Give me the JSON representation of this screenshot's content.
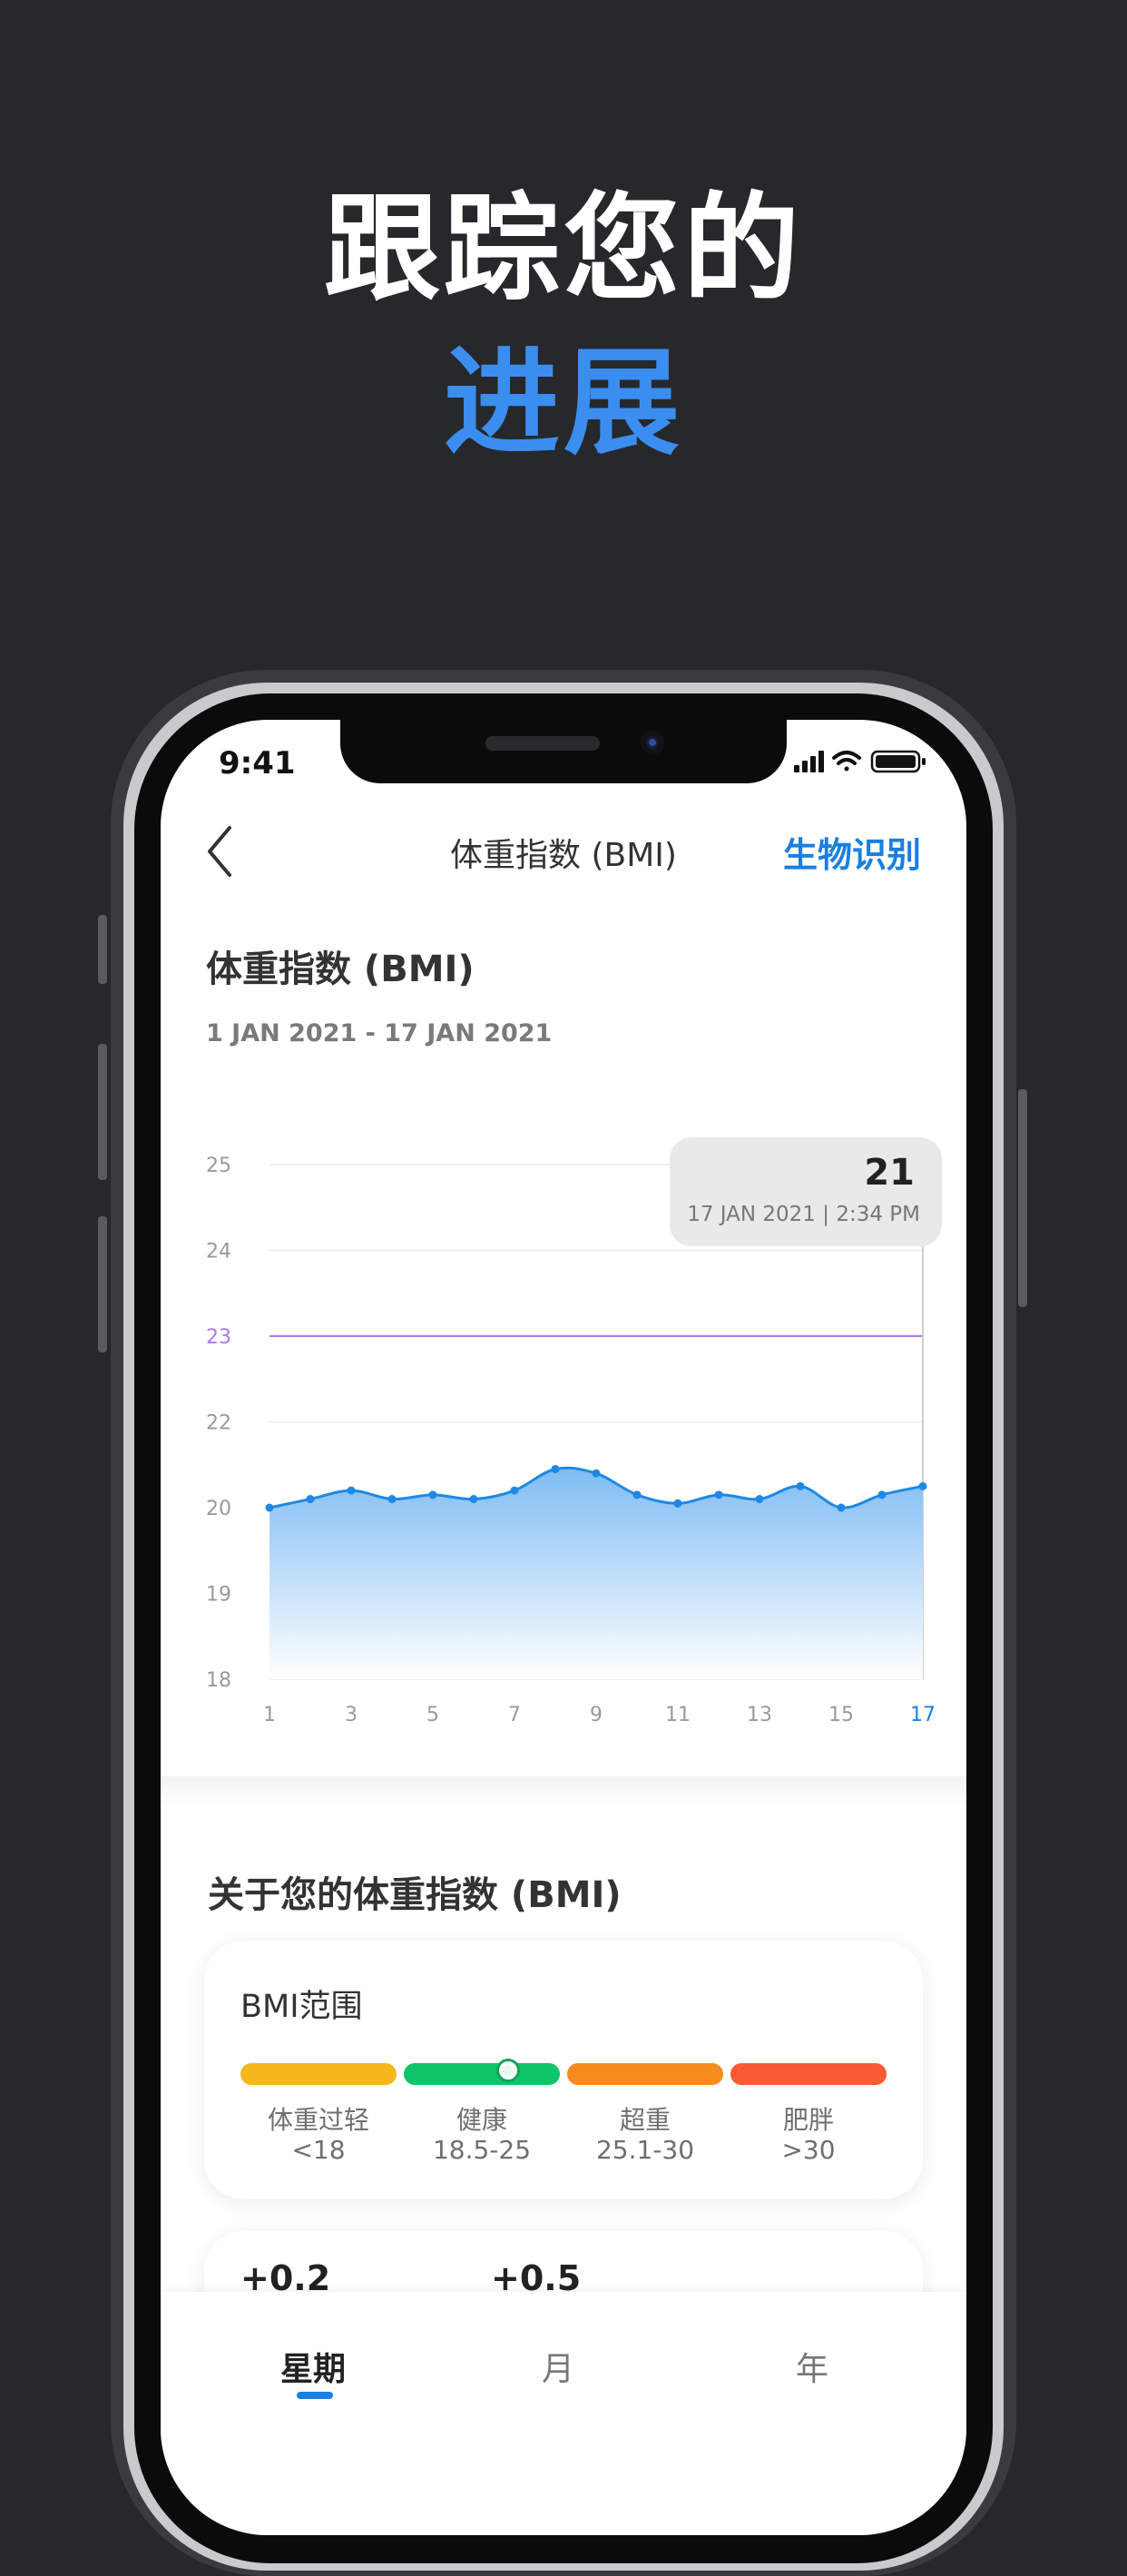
{
  "promo": {
    "line1": "跟踪您的",
    "line2": "进展"
  },
  "status_bar": {
    "time": "9:41"
  },
  "nav": {
    "title": "体重指数 (BMI)",
    "action": "生物识别"
  },
  "card": {
    "title": "体重指数 (BMI)",
    "date_range": "1 JAN 2021 - 17 JAN 2021"
  },
  "tooltip": {
    "value": "21",
    "date": "17 JAN 2021 | 2:34 PM"
  },
  "chart_data": {
    "type": "area",
    "y_ticks": [
      "25",
      "24",
      "23",
      "22",
      "20",
      "19",
      "18"
    ],
    "x_ticks": [
      "1",
      "3",
      "5",
      "7",
      "9",
      "11",
      "13",
      "15",
      "17"
    ],
    "x": [
      1,
      2,
      3,
      4,
      5,
      6,
      7,
      8,
      9,
      10,
      11,
      12,
      13,
      14,
      15,
      16,
      17
    ],
    "values": [
      20.0,
      20.2,
      20.4,
      20.2,
      20.3,
      20.2,
      20.4,
      20.9,
      20.8,
      20.3,
      20.1,
      20.3,
      20.2,
      20.5,
      20.0,
      20.3,
      20.5
    ],
    "reference_line": {
      "label": "23",
      "color": "#a97be6"
    },
    "highlight_x": "17",
    "series_color": "#1e88e5"
  },
  "about": {
    "title": "关于您的体重指数 (BMI)"
  },
  "bmi_range": {
    "title": "BMI范围",
    "segments": [
      {
        "label": "体重过轻",
        "range": "<18",
        "color": "#f5b71c"
      },
      {
        "label": "健康",
        "range": "18.5-25",
        "color": "#0fc56a"
      },
      {
        "label": "超重",
        "range": "25.1-30",
        "color": "#f78c1e"
      },
      {
        "label": "肥胖",
        "range": ">30",
        "color": "#fb5a32"
      }
    ]
  },
  "next_card": {
    "value1": "+0.2",
    "value2": "+0.5"
  },
  "tabs": [
    {
      "label": "星期"
    },
    {
      "label": "月"
    },
    {
      "label": "年"
    }
  ]
}
